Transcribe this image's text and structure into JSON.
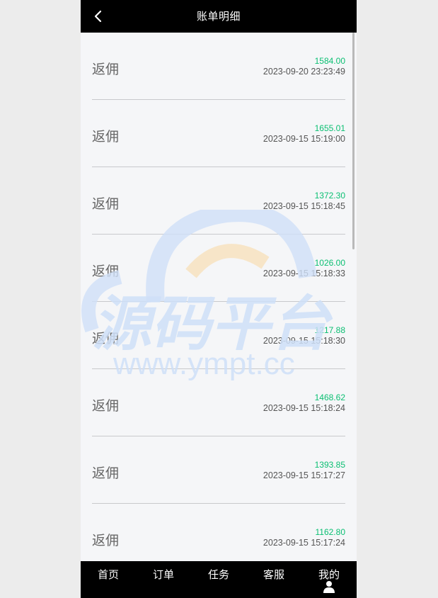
{
  "header": {
    "title": "账单明细",
    "back_icon": "chevron-left-icon"
  },
  "records": [
    {
      "label": "返佣",
      "amount": "1584.00",
      "time": "2023-09-20 23:23:49"
    },
    {
      "label": "返佣",
      "amount": "1655.01",
      "time": "2023-09-15 15:19:00"
    },
    {
      "label": "返佣",
      "amount": "1372.30",
      "time": "2023-09-15 15:18:45"
    },
    {
      "label": "返佣",
      "amount": "1026.00",
      "time": "2023-09-15 15:18:33"
    },
    {
      "label": "返佣",
      "amount": "1217.88",
      "time": "2023-09-15 15:18:30"
    },
    {
      "label": "返佣",
      "amount": "1468.62",
      "time": "2023-09-15 15:18:24"
    },
    {
      "label": "返佣",
      "amount": "1393.85",
      "time": "2023-09-15 15:17:27"
    },
    {
      "label": "返佣",
      "amount": "1162.80",
      "time": "2023-09-15 15:17:24"
    }
  ],
  "watermark": {
    "brand": "源码平台",
    "url": "www.ympt.cc"
  },
  "tabbar": {
    "items": [
      {
        "label": "首页"
      },
      {
        "label": "订单"
      },
      {
        "label": "任务"
      },
      {
        "label": "客服"
      },
      {
        "label": "我的",
        "icon": "user-icon"
      }
    ]
  },
  "colors": {
    "header_bg": "#000000",
    "page_bg": "#f5f6f8",
    "amount": "#0abf72",
    "label": "#666666",
    "watermark_blue": "#cfe0f8",
    "watermark_orange": "#f7e3c2"
  }
}
